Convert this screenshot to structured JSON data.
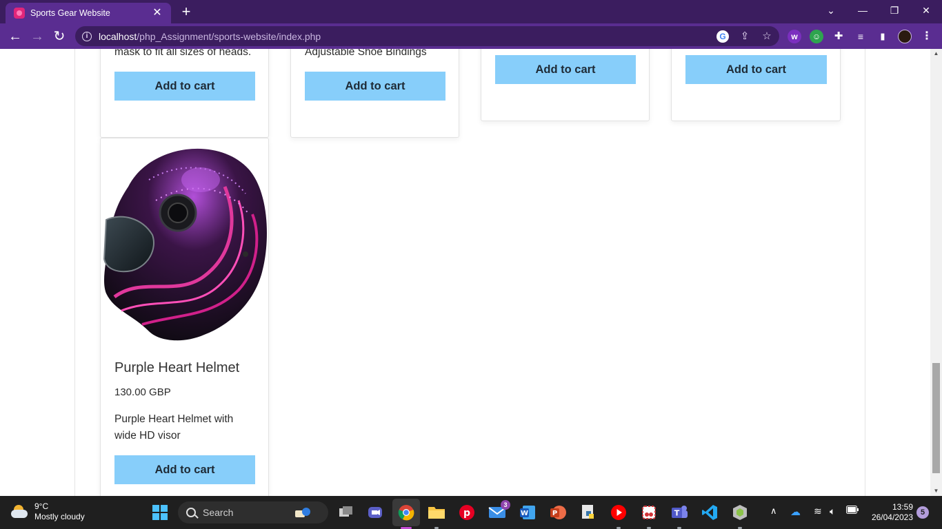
{
  "browser": {
    "tab_title": "Sports Gear Website",
    "url_host": "localhost",
    "url_path": "/php_Assignment/sports-website/index.php"
  },
  "products_partial": [
    {
      "desc_tail": "mask to fit all sizes of heads.",
      "button": "Add to cart"
    },
    {
      "desc_tail": "Adjustable Shoe Bindings",
      "button": "Add to cart"
    },
    {
      "button": "Add to cart"
    },
    {
      "button": "Add to cart"
    }
  ],
  "product_helmet": {
    "title": "Purple Heart Helmet",
    "price": "130.00 GBP",
    "description": "Purple Heart Helmet with wide HD visor",
    "button": "Add to cart"
  },
  "taskbar": {
    "temperature": "9°C",
    "weather": "Mostly cloudy",
    "search_placeholder": "Search",
    "mail_badge": "3",
    "time": "13:59",
    "date": "26/04/2023",
    "notifications": "5"
  },
  "colors": {
    "chrome_dark": "#3b1d5f",
    "chrome_toolbar": "#5a2d91",
    "cart_button": "#87cefa"
  }
}
